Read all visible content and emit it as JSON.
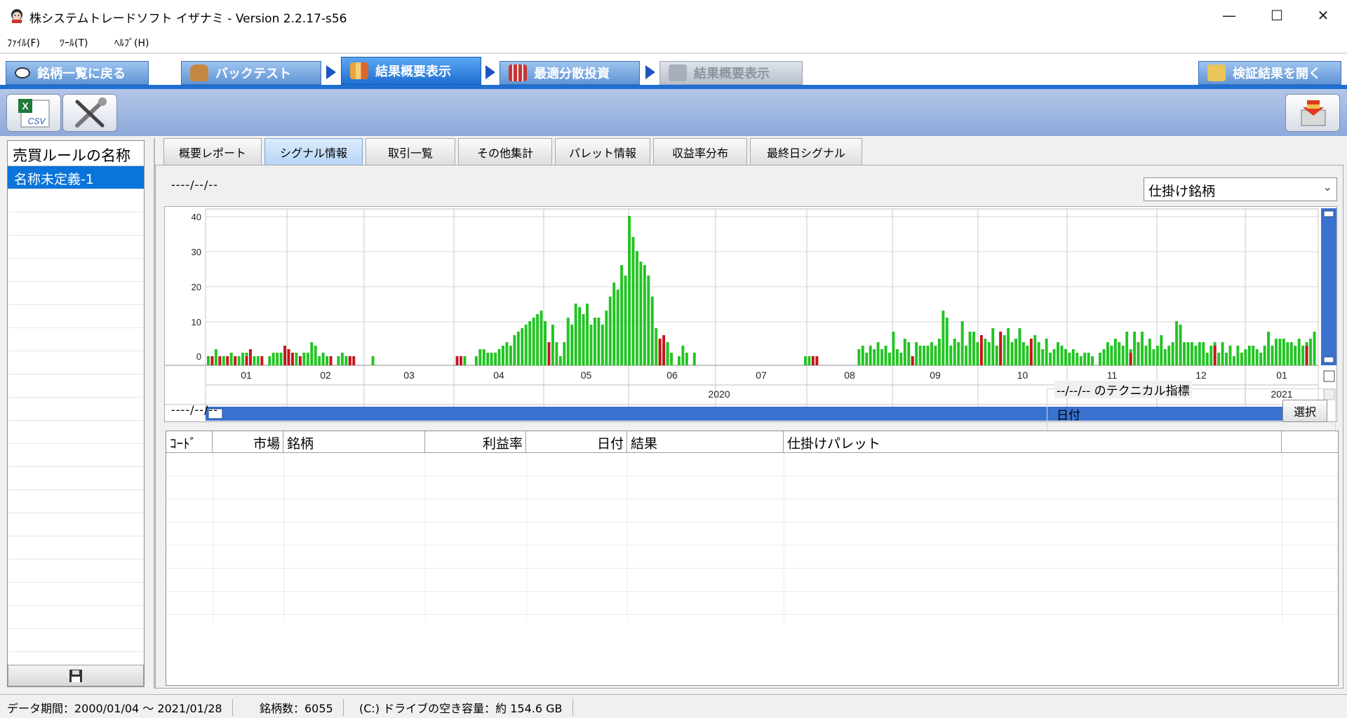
{
  "window": {
    "title": "株システムトレードソフト イザナミ - Version 2.2.17-s56",
    "minimize": "—",
    "maximize": "☐",
    "close": "✕"
  },
  "menu": [
    "ﾌｧｲﾙ(F)",
    "ﾂｰﾙ(T)",
    "ﾍﾙﾌﾟ(H)"
  ],
  "workflow_tabs": [
    {
      "label": "銘柄一覧に戻る",
      "state": "normal",
      "icon": "eye-icon"
    },
    {
      "label": "バックテスト",
      "state": "normal",
      "icon": "bag-icon"
    },
    {
      "label": "結果概要表示",
      "state": "active",
      "icon": "chart-icon"
    },
    {
      "label": "最適分散投資",
      "state": "normal",
      "icon": "grid-icon"
    },
    {
      "label": "結果概要表示",
      "state": "disabled",
      "icon": "chart-icon"
    }
  ],
  "open_results_label": "検証結果を開く",
  "toolbar": {
    "csv_icon": "excel-csv-icon",
    "tools_icon": "wrench-screwdriver-icon",
    "csv_text": "CSV",
    "export_icon": "box-arrow-icon"
  },
  "left_panel": {
    "header": "売買ルールの名称",
    "items": [
      "名称未定義-1"
    ],
    "save_icon": "floppy-disk-icon"
  },
  "sub_tabs": [
    "概要レポート",
    "シグナル情報",
    "取引一覧",
    "その他集計",
    "パレット情報",
    "収益率分布",
    "最終日シグナル"
  ],
  "active_sub_tab": 1,
  "signal": {
    "date_top": "----/--/--",
    "combo_value": "仕掛け銘柄",
    "date_bottom": "----/--/--",
    "technical_title": "--/--/-- のテクニカル指標",
    "technical_date_label": "日付",
    "select_button": "選択"
  },
  "table": {
    "columns": [
      "ｺｰﾄﾞ",
      "市場",
      "銘柄",
      "利益率",
      "日付",
      "結果",
      "仕掛けパレット"
    ],
    "rows": []
  },
  "status": {
    "period": "データ期間：2000/01/04 〜 2021/01/28",
    "count": "銘柄数：6055",
    "disk": "(C:) ドライブの空き容量：約 154.6 GB"
  },
  "colors": {
    "up_bar": "#22c422",
    "down_bar": "#c4151c",
    "accent": "#1f6fd2",
    "selection": "#0a74da"
  },
  "chart_data": {
    "type": "bar",
    "yticks": [
      "40",
      "30",
      "20",
      "10",
      "0"
    ],
    "ylim": [
      0,
      40
    ],
    "month_labels": [
      "01",
      "02",
      "03",
      "04",
      "05",
      "06",
      "07",
      "08",
      "09",
      "10",
      "11",
      "12",
      "01"
    ],
    "year_labels": [
      "2020",
      "2021"
    ],
    "series": [
      {
        "name": "green",
        "values": [
          1,
          1,
          3,
          0,
          1,
          0,
          2,
          0,
          1,
          2,
          2,
          0,
          1,
          1,
          0,
          0,
          1,
          2,
          2,
          2,
          0,
          0,
          0,
          2,
          0,
          2,
          2,
          5,
          4,
          1,
          2,
          1,
          0,
          0,
          1,
          2,
          1,
          1,
          0,
          0,
          0,
          0,
          0,
          1,
          0,
          0,
          0,
          0,
          0,
          0,
          0,
          0,
          0,
          0,
          0,
          0,
          0,
          0,
          0,
          0,
          0,
          0,
          0,
          0,
          0,
          0,
          0,
          1,
          0,
          0,
          1,
          3,
          3,
          2,
          2,
          2,
          3,
          4,
          5,
          4,
          7,
          8,
          9,
          10,
          11,
          12,
          13,
          14,
          11,
          0,
          10,
          5,
          1,
          5,
          12,
          10,
          16,
          15,
          13,
          16,
          10,
          12,
          12,
          10,
          14,
          18,
          22,
          20,
          27,
          24,
          41,
          35,
          31,
          28,
          27,
          24,
          18,
          9,
          5,
          3,
          5,
          2,
          0,
          1,
          4,
          2,
          0,
          2,
          0,
          0,
          0,
          0,
          0,
          0,
          0,
          0,
          0,
          0,
          0,
          0,
          0,
          0,
          0,
          0,
          0,
          0,
          0,
          0,
          0,
          0,
          0,
          0,
          0,
          0,
          0,
          0,
          1,
          1,
          0,
          0,
          0,
          0,
          0,
          0,
          0,
          0,
          0,
          0,
          0,
          0,
          3,
          4,
          2,
          4,
          3,
          5,
          3,
          4,
          2,
          8,
          3,
          2,
          6,
          5,
          1,
          5,
          4,
          4,
          4,
          5,
          4,
          6,
          14,
          12,
          4,
          6,
          5,
          11,
          4,
          8,
          8,
          5,
          3,
          6,
          5,
          9,
          4,
          4,
          7,
          9,
          5,
          6,
          9,
          5,
          4,
          2,
          7,
          5,
          3,
          6,
          2,
          3,
          5,
          4,
          3,
          2,
          3,
          2,
          1,
          2,
          2,
          1,
          0,
          2,
          3,
          5,
          4,
          6,
          5,
          4,
          8,
          3,
          8,
          5,
          8,
          4,
          6,
          3,
          4,
          7,
          3,
          4,
          5,
          11,
          10,
          5,
          5,
          5,
          4,
          5,
          5,
          2,
          4,
          5,
          2,
          5,
          2,
          4,
          1,
          4,
          2,
          3,
          4,
          4,
          3,
          2,
          4,
          8,
          4,
          6,
          6,
          6,
          5,
          5,
          4,
          6,
          4,
          5,
          6,
          8
        ]
      },
      {
        "name": "red",
        "values": [
          0,
          1,
          0,
          1,
          0,
          1,
          0,
          1,
          0,
          0,
          1,
          3,
          0,
          0,
          1,
          0,
          0,
          0,
          0,
          0,
          4,
          3,
          2,
          0,
          1,
          0,
          0,
          0,
          0,
          0,
          0,
          0,
          1,
          0,
          0,
          0,
          0,
          1,
          1,
          0,
          0,
          0,
          0,
          0,
          0,
          0,
          0,
          0,
          0,
          0,
          0,
          0,
          0,
          0,
          0,
          0,
          0,
          0,
          0,
          0,
          0,
          0,
          0,
          0,
          0,
          1,
          1,
          0,
          0,
          0,
          0,
          0,
          0,
          0,
          0,
          0,
          0,
          0,
          0,
          0,
          0,
          0,
          0,
          0,
          0,
          0,
          0,
          0,
          0,
          5,
          0,
          0,
          0,
          0,
          0,
          0,
          0,
          0,
          0,
          0,
          0,
          0,
          0,
          0,
          0,
          0,
          0,
          0,
          0,
          0,
          0,
          0,
          0,
          0,
          0,
          0,
          0,
          0,
          6,
          7,
          0,
          0,
          0,
          0,
          0,
          0,
          0,
          0,
          0,
          0,
          0,
          0,
          0,
          0,
          0,
          0,
          0,
          0,
          0,
          0,
          0,
          0,
          0,
          0,
          0,
          0,
          0,
          0,
          0,
          0,
          0,
          0,
          0,
          0,
          0,
          0,
          0,
          0,
          1,
          1,
          0,
          0,
          0,
          0,
          0,
          0,
          0,
          0,
          0,
          0,
          0,
          0,
          0,
          0,
          0,
          0,
          0,
          0,
          0,
          0,
          0,
          0,
          0,
          0,
          1,
          0,
          0,
          0,
          0,
          0,
          0,
          0,
          0,
          0,
          0,
          0,
          0,
          0,
          0,
          0,
          0,
          0,
          7,
          0,
          0,
          0,
          0,
          8,
          0,
          0,
          0,
          0,
          0,
          0,
          0,
          6,
          0,
          0,
          0,
          0,
          0,
          0,
          0,
          0,
          0,
          0,
          0,
          0,
          0,
          0,
          0,
          0,
          0,
          0,
          0,
          0,
          0,
          0,
          0,
          0,
          0,
          2,
          0,
          0,
          0,
          0,
          0,
          0,
          0,
          0,
          0,
          0,
          0,
          0,
          0,
          0,
          0,
          0,
          0,
          0,
          0,
          0,
          0,
          4,
          0,
          0,
          0,
          0,
          0,
          0,
          0,
          0,
          0,
          0,
          0,
          0,
          0,
          0,
          0,
          0,
          0,
          0,
          0,
          0,
          0,
          0,
          0,
          4,
          0,
          0,
          0,
          0,
          0,
          0,
          0,
          0,
          0,
          0,
          0,
          5,
          0,
          0,
          0,
          0
        ]
      }
    ]
  }
}
